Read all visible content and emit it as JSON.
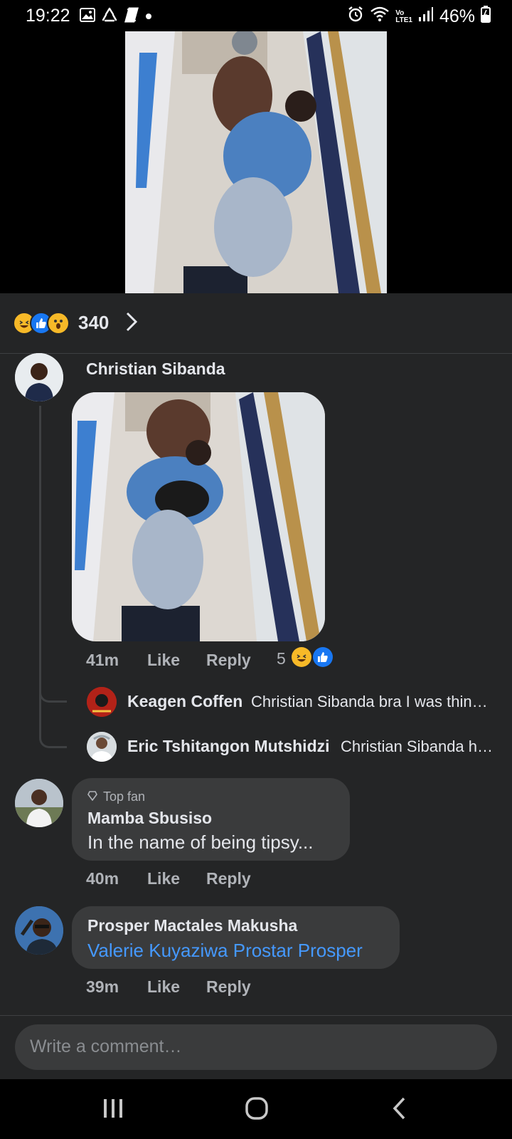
{
  "status_bar": {
    "time": "19:22",
    "left_icons": [
      "gallery-icon",
      "recycle-icon",
      "netflix-icon",
      "dot-icon"
    ],
    "right_icons": [
      "alarm-icon",
      "wifi-icon",
      "volte-icon",
      "signal-icon"
    ],
    "volte_label": "Vo\nLTE1",
    "battery": "46%"
  },
  "post": {
    "media": "video-thumbnail",
    "reactions": [
      "haha",
      "like",
      "wow"
    ],
    "reaction_count": "340"
  },
  "comments": [
    {
      "author": "Christian Sibanda",
      "has_image": true,
      "time": "41m",
      "like_label": "Like",
      "reply_label": "Reply",
      "reaction_count": "5",
      "reaction_types": [
        "haha",
        "like"
      ],
      "replies": [
        {
          "author": "Keagen Coffen",
          "text": "Christian Sibanda bra I was thin…"
        },
        {
          "author": "Eric Tshitangon Mutshidzi",
          "text": "Christian Sibanda h…"
        }
      ]
    },
    {
      "badge": "Top fan",
      "author": "Mamba Sbusiso",
      "text": "In the name of being tipsy...",
      "time": "40m",
      "like_label": "Like",
      "reply_label": "Reply"
    },
    {
      "author": "Prosper Mactales Makusha",
      "mention": "Valerie Kuyaziwa Prostar Prosper",
      "time": "39m",
      "like_label": "Like",
      "reply_label": "Reply"
    }
  ],
  "composer": {
    "placeholder": "Write a comment…"
  },
  "colors": {
    "background": "#242526",
    "bubble": "#3a3b3c",
    "mention_link": "#4599ff",
    "like_blue": "#1877f2",
    "haha_yellow": "#f7b928"
  },
  "nav": [
    "recent-apps-icon",
    "home-icon",
    "back-icon"
  ]
}
